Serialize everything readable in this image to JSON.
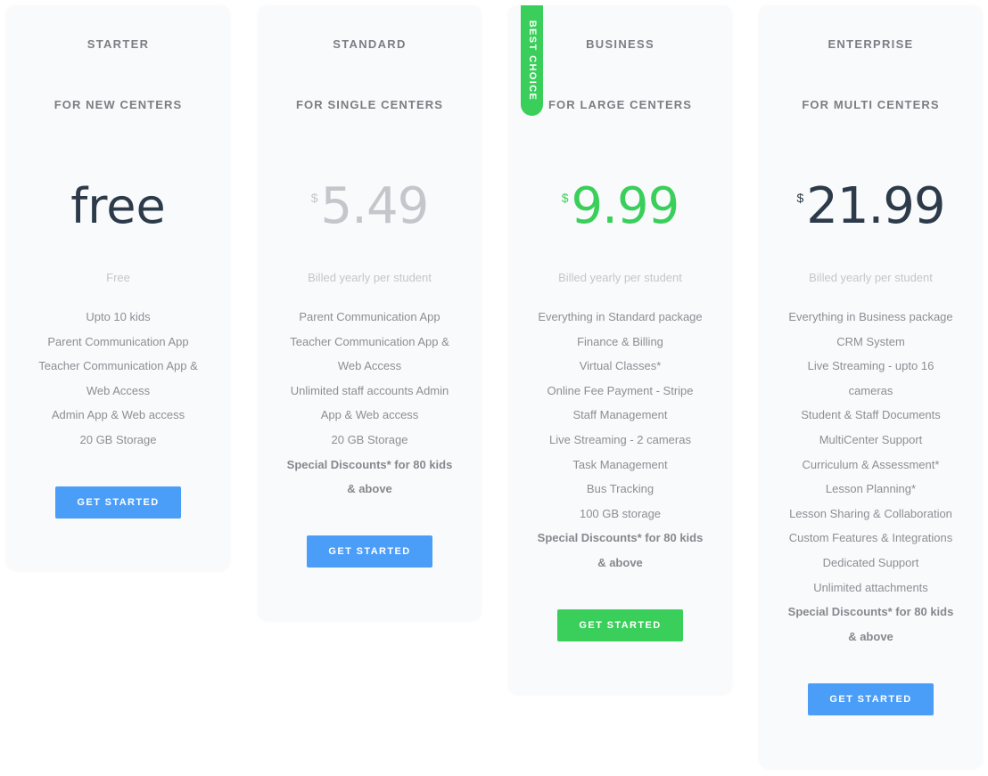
{
  "colors": {
    "accent_blue": "#4b9ef8",
    "accent_green": "#39cf5a",
    "price_dark": "#2c3a4a",
    "price_light": "#c3c6cb"
  },
  "plans": [
    {
      "name": "STARTER",
      "subtitle": "FOR NEW CENTERS",
      "price_text": "free",
      "billing": "Free",
      "features": [
        "Upto 10 kids",
        "Parent Communication App",
        "Teacher Communication App &",
        "Web Access",
        "Admin App & Web access",
        "20 GB Storage"
      ],
      "button": "GET STARTED"
    },
    {
      "name": "STANDARD",
      "subtitle": "FOR SINGLE CENTERS",
      "currency": "$",
      "price": "5.49",
      "billing": "Billed yearly per student",
      "features": [
        "Parent Communication App",
        "Teacher Communication App &",
        "Web Access",
        "Unlimited staff accounts Admin",
        "App & Web access",
        "20 GB Storage"
      ],
      "highlight_features": [
        "Special Discounts* for 80 kids",
        "& above"
      ],
      "button": "GET STARTED"
    },
    {
      "name": "BUSINESS",
      "subtitle": "FOR LARGE CENTERS",
      "badge": "BEST CHOICE",
      "currency": "$",
      "price": "9.99",
      "billing": "Billed yearly per student",
      "features": [
        "Everything in Standard package",
        "Finance & Billing",
        "Virtual Classes*",
        "Online Fee Payment - Stripe",
        "Staff Management",
        "Live Streaming - 2 cameras",
        "Task Management",
        "Bus Tracking",
        "100 GB storage"
      ],
      "highlight_features": [
        "Special Discounts* for 80 kids",
        "& above"
      ],
      "button": "GET STARTED"
    },
    {
      "name": "ENTERPRISE",
      "subtitle": "FOR MULTI CENTERS",
      "currency": "$",
      "price": "21.99",
      "billing": "Billed yearly per student",
      "features": [
        "Everything in Business package",
        "CRM System",
        "Live Streaming - upto 16",
        "cameras",
        "Student & Staff Documents",
        "MultiCenter Support",
        "Curriculum & Assessment*",
        "Lesson Planning*",
        "Lesson Sharing & Collaboration",
        "Custom Features & Integrations",
        "Dedicated Support",
        "Unlimited attachments"
      ],
      "highlight_features": [
        "Special Discounts* for 80 kids",
        "& above"
      ],
      "button": "GET STARTED"
    }
  ]
}
